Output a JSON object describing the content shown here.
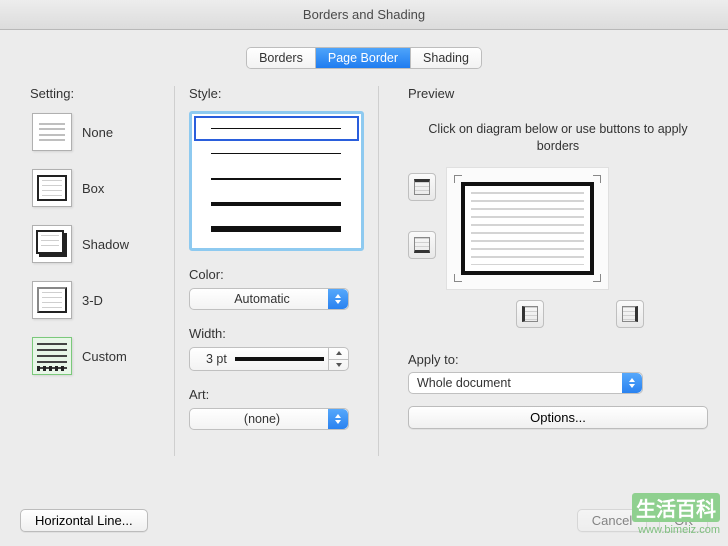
{
  "window": {
    "title": "Borders and Shading"
  },
  "tabs": [
    {
      "label": "Borders",
      "active": false
    },
    {
      "label": "Page Border",
      "active": true
    },
    {
      "label": "Shading",
      "active": false
    }
  ],
  "setting": {
    "label": "Setting:",
    "options": [
      {
        "key": "none",
        "label": "None"
      },
      {
        "key": "box",
        "label": "Box"
      },
      {
        "key": "shadow",
        "label": "Shadow"
      },
      {
        "key": "threed",
        "label": "3-D"
      },
      {
        "key": "custom",
        "label": "Custom"
      }
    ],
    "selected": "custom"
  },
  "style": {
    "label": "Style:",
    "lines": [
      {
        "weight": 1,
        "variant": "solid",
        "selected": true
      },
      {
        "weight": 1,
        "variant": "solid"
      },
      {
        "weight": 2,
        "variant": "solid"
      },
      {
        "weight": 4,
        "variant": "solid"
      },
      {
        "weight": 6,
        "variant": "solid"
      },
      {
        "weight": 8,
        "variant": "solid"
      }
    ]
  },
  "color": {
    "label": "Color:",
    "value": "Automatic"
  },
  "width": {
    "label": "Width:",
    "value": "3 pt"
  },
  "art": {
    "label": "Art:",
    "value": "(none)"
  },
  "preview": {
    "label": "Preview",
    "instruction": "Click on diagram below or use buttons to apply borders"
  },
  "apply": {
    "label": "Apply to:",
    "value": "Whole document"
  },
  "buttons": {
    "options": "Options...",
    "horizontal_line": "Horizontal Line...",
    "cancel": "Cancel",
    "ok": "OK"
  },
  "watermark": {
    "cn": "生活百科",
    "url": "www.bimeiz.com"
  }
}
